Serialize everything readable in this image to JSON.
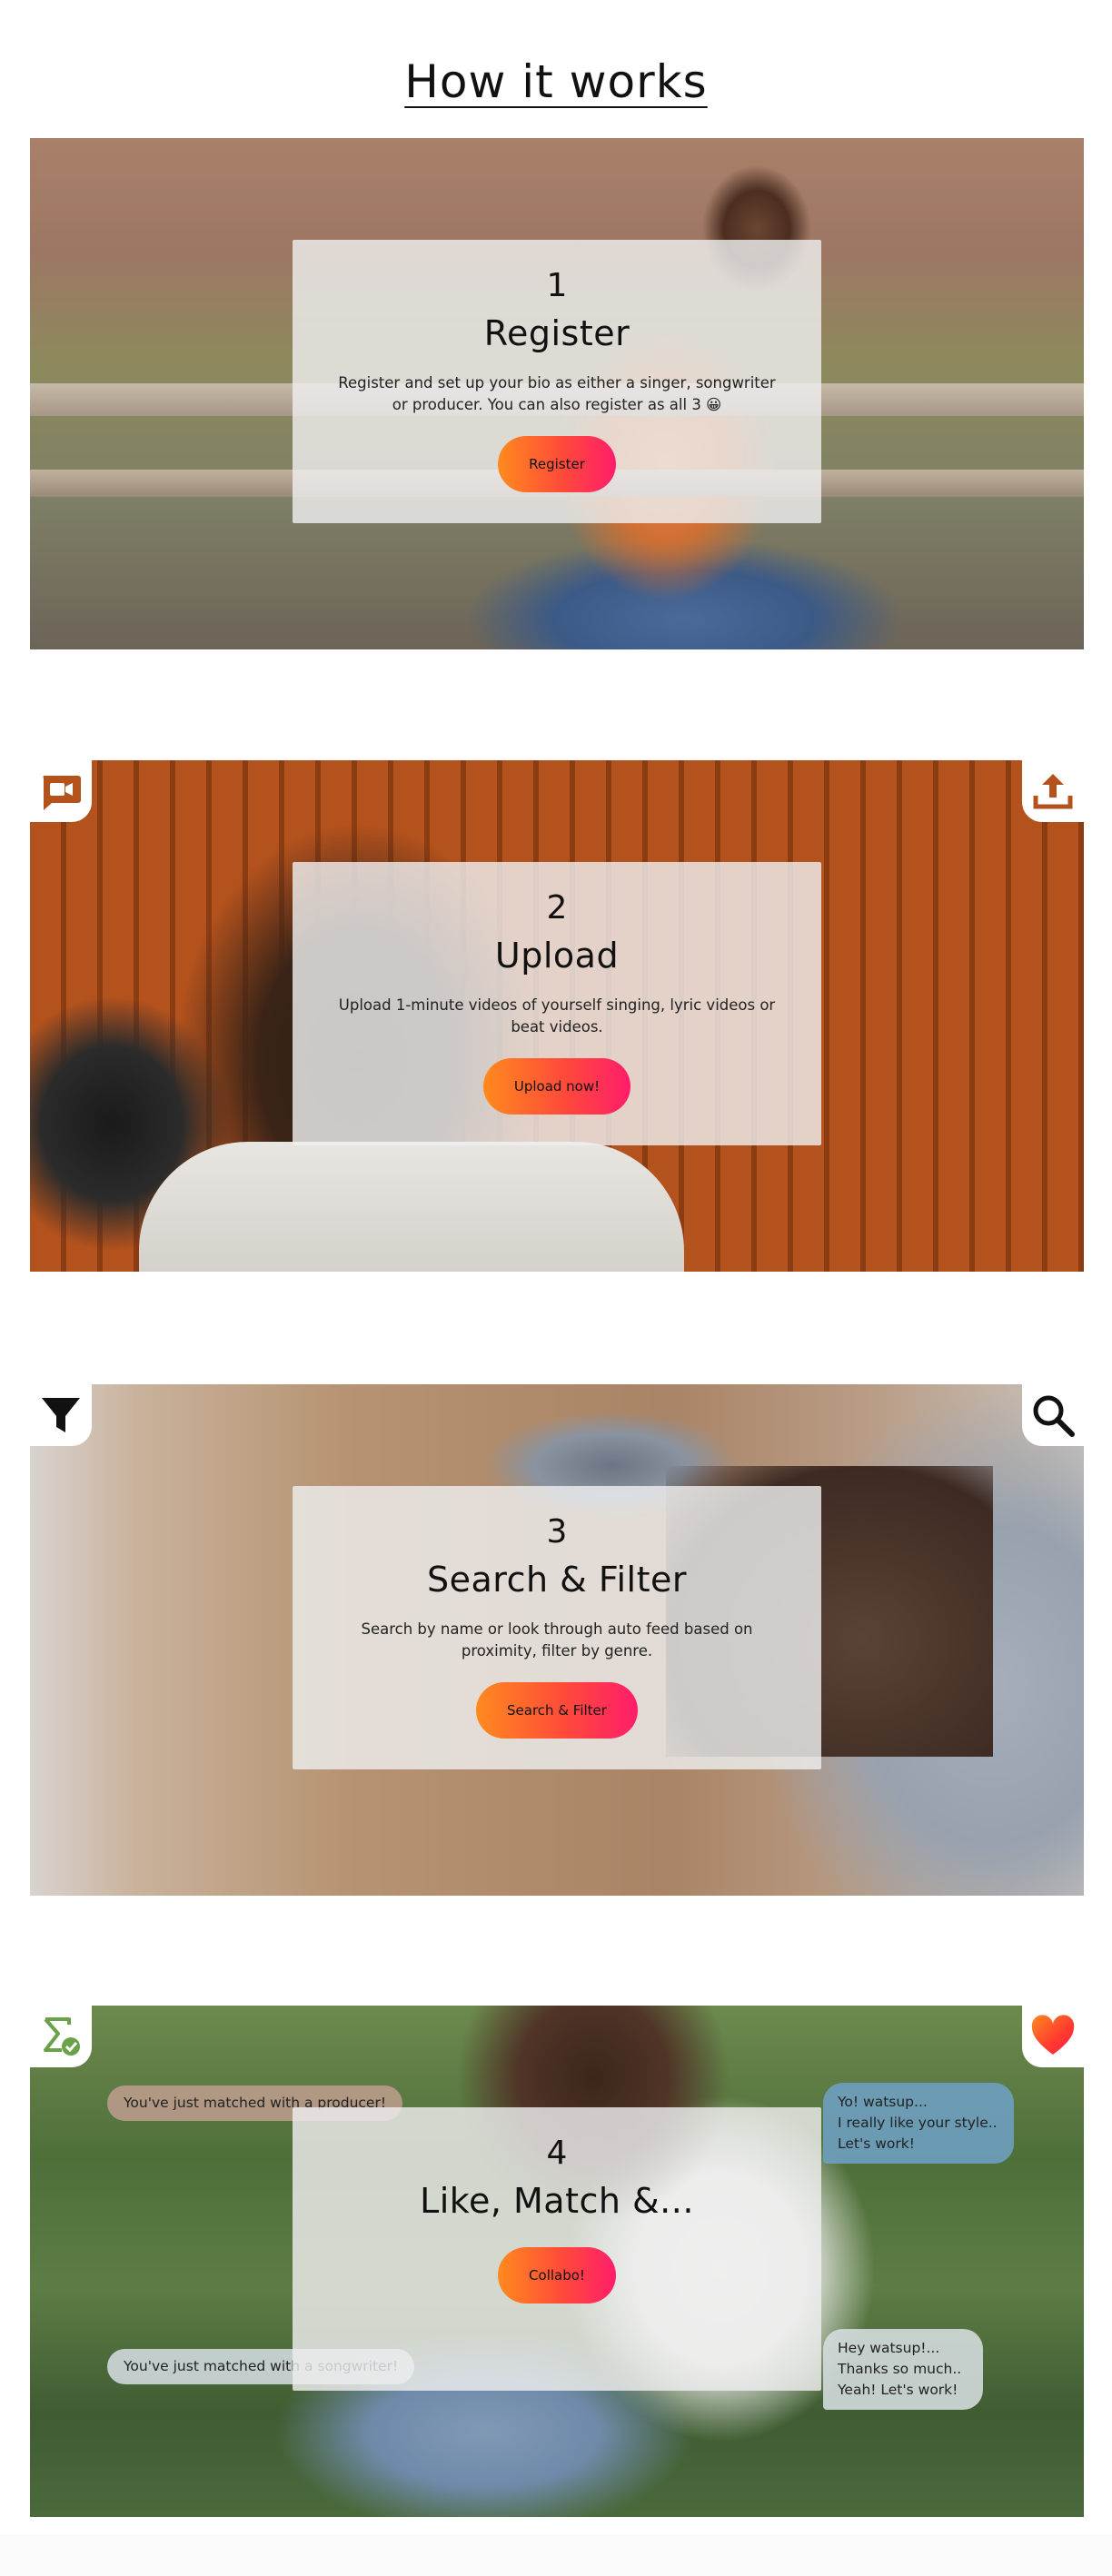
{
  "page": {
    "title": "How it works"
  },
  "steps": [
    {
      "number": "1",
      "title": "Register",
      "text": "Register and set up your bio as either a singer, songwriter or producer. You can also register as all 3 😀",
      "button": "Register"
    },
    {
      "number": "2",
      "title": "Upload",
      "text": "Upload 1-minute videos of yourself singing, lyric videos or beat videos.",
      "button": "Upload now!",
      "icons": {
        "left": "video-chat-icon",
        "right": "upload-icon"
      }
    },
    {
      "number": "3",
      "title": "Search & Filter",
      "text": "Search by name or look through auto feed based on proximity, filter by genre.",
      "button": "Search & Filter",
      "icons": {
        "left": "filter-icon",
        "right": "search-icon"
      }
    },
    {
      "number": "4",
      "title": "Like, Match &...",
      "text": "",
      "button": "Collabo!",
      "icons": {
        "left": "sum-check-icon",
        "right": "heart-icon"
      },
      "bubbles": {
        "match_producer": "You've just matched with a producer!",
        "match_songwriter": "You've just matched with a songwriter!",
        "message_1": [
          "Yo! watsup...",
          "I really like your style..",
          "Let's work!"
        ],
        "message_2": [
          "Hey watsup!...",
          "Thanks so much..",
          "Yeah! Let's work!"
        ]
      }
    }
  ],
  "colors": {
    "button_gradient": [
      "#ff8a1e",
      "#ff4a3a",
      "#ff1d6a"
    ],
    "upload_icon": "#b4521d",
    "sum_icon": "#6aa24a",
    "heart": "#ff3a2f"
  }
}
